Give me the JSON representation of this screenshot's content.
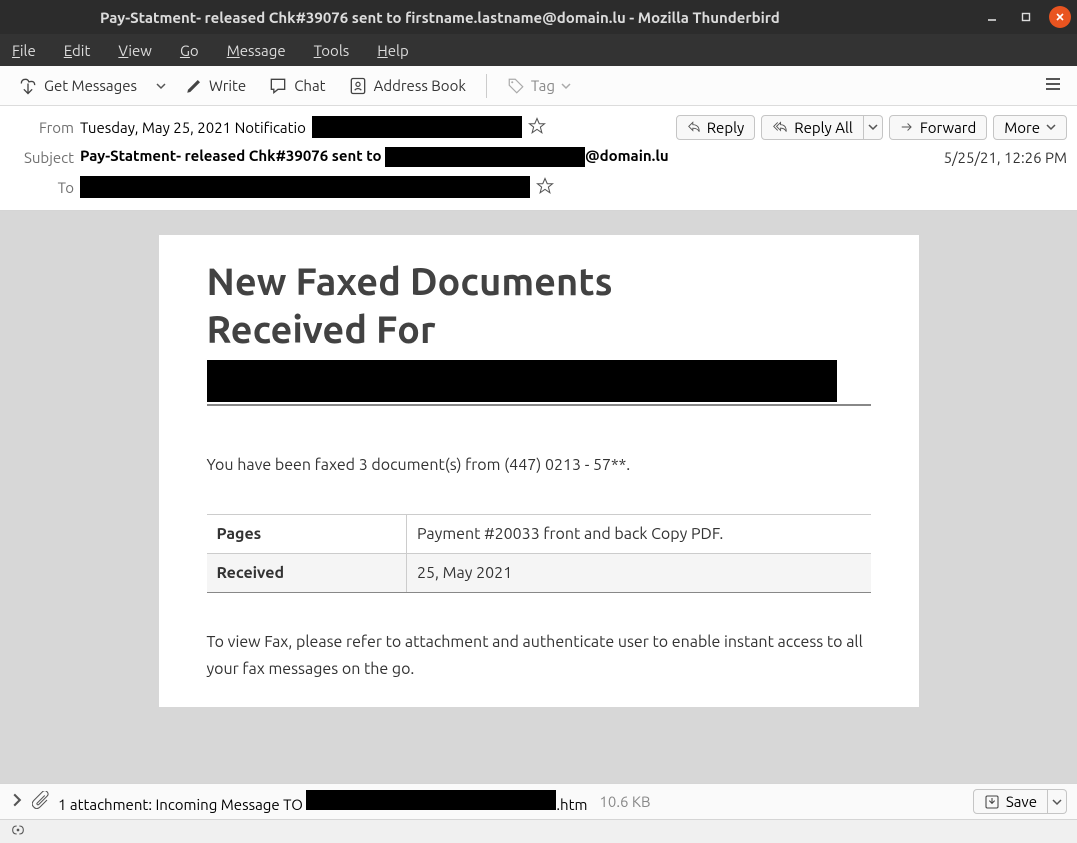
{
  "window": {
    "title": "Pay-Statment- released Chk#39076 sent to firstname.lastname@domain.lu - Mozilla Thunderbird"
  },
  "menubar": {
    "file": "File",
    "edit": "Edit",
    "view": "View",
    "go": "Go",
    "message": "Message",
    "tools": "Tools",
    "help": "Help"
  },
  "toolbar": {
    "get_messages": "Get Messages",
    "write": "Write",
    "chat": "Chat",
    "address_book": "Address Book",
    "tag": "Tag"
  },
  "header": {
    "from_label": "From",
    "from_value_prefix": "Tuesday, May 25, 2021 Notificatio",
    "subject_label": "Subject",
    "subject_prefix": "Pay-Statment- released Chk#39076 sent to ",
    "subject_suffix": "@domain.lu",
    "to_label": "To",
    "date": "5/25/21, 12:26 PM",
    "reply": "Reply",
    "reply_all": "Reply All",
    "forward": "Forward",
    "more": "More"
  },
  "body": {
    "title_line1": "New Faxed Documents",
    "title_line2": "Received For",
    "intro": "You have been faxed 3 document(s) from (447) 0213 - 57**.",
    "rows": [
      {
        "k": "Pages",
        "v": "Payment #20033 front and back Copy PDF."
      },
      {
        "k": "Received",
        "v": "25, May 2021"
      }
    ],
    "instructions": "To  view Fax, please refer to  attachment and authenticate user to  enable instant access to all your fax messages on the go."
  },
  "attachment": {
    "label_prefix": "1 attachment: Incoming Message TO ",
    "label_suffix": ".htm",
    "size": "10.6 KB",
    "save": "Save"
  }
}
